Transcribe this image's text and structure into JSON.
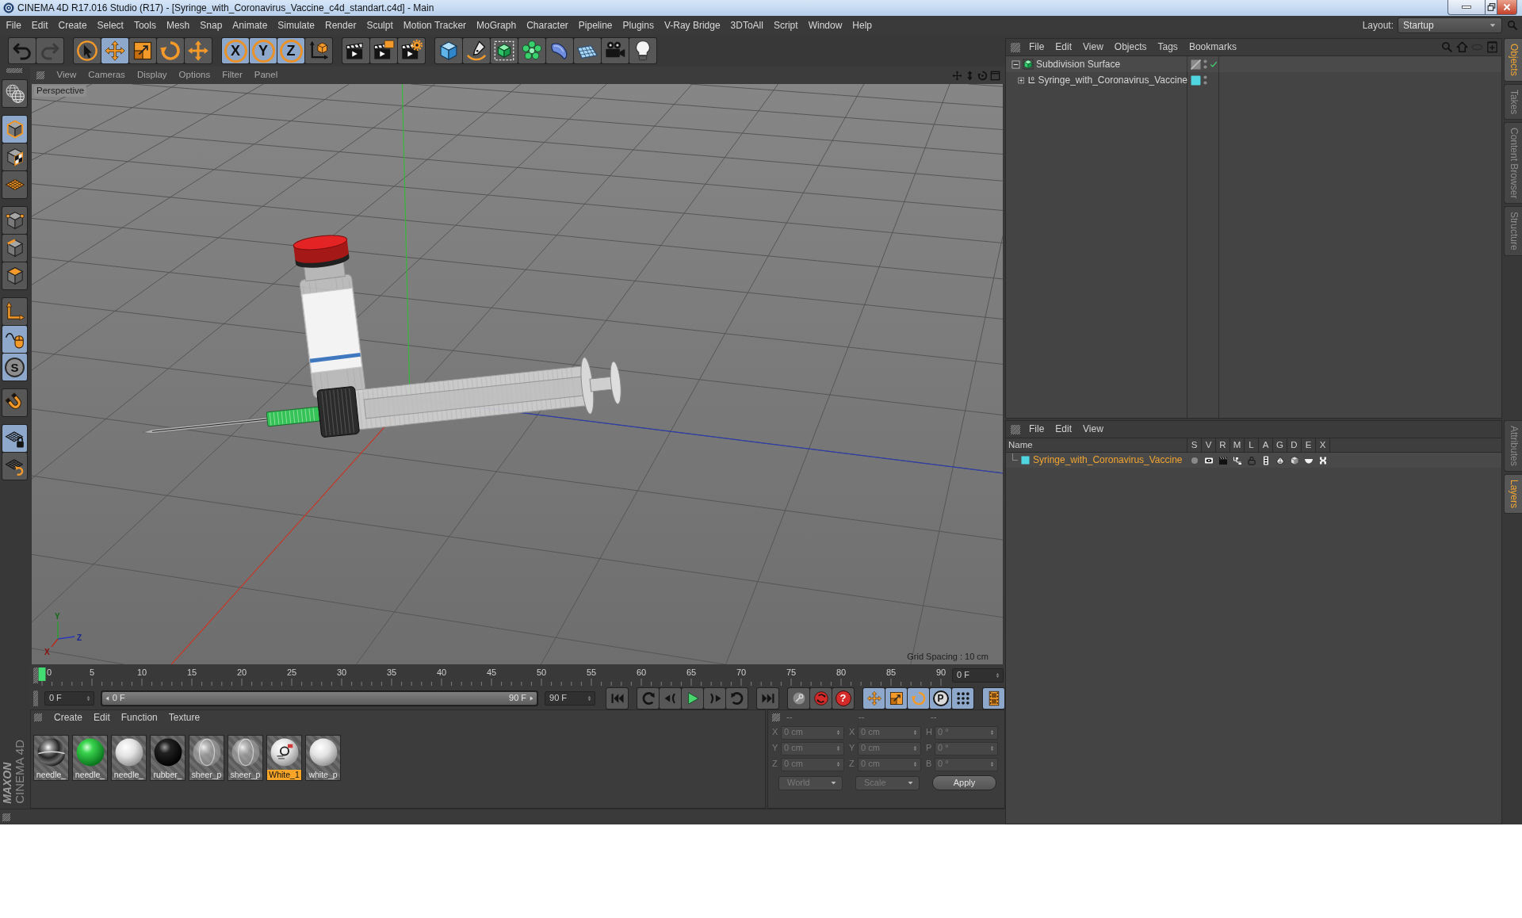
{
  "window": {
    "title": "CINEMA 4D R17.016 Studio (R17) - [Syringe_with_Coronavirus_Vaccine_c4d_standart.c4d] - Main"
  },
  "menu_bar": {
    "items": [
      "File",
      "Edit",
      "Create",
      "Select",
      "Tools",
      "Mesh",
      "Snap",
      "Animate",
      "Simulate",
      "Render",
      "Sculpt",
      "Motion Tracker",
      "MoGraph",
      "Character",
      "Pipeline",
      "Plugins",
      "V-Ray Bridge",
      "3DToAll",
      "Script",
      "Window",
      "Help"
    ],
    "layout_label": "Layout:",
    "layout_value": "Startup"
  },
  "toolbar": {
    "groups": [
      {
        "buttons": [
          {
            "kind": "undo",
            "active": false,
            "disabled": false
          },
          {
            "kind": "redo",
            "active": false,
            "disabled": true
          }
        ]
      },
      {
        "buttons": [
          {
            "kind": "live_selection",
            "active": false
          },
          {
            "kind": "move",
            "active": true
          },
          {
            "kind": "scale",
            "active": false
          },
          {
            "kind": "rotate",
            "active": false
          },
          {
            "kind": "recent_tool",
            "active": false
          }
        ]
      },
      {
        "buttons": [
          {
            "kind": "axis_lock",
            "label": "X",
            "active": true
          },
          {
            "kind": "axis_lock",
            "label": "Y",
            "active": true
          },
          {
            "kind": "axis_lock",
            "label": "Z",
            "active": true
          },
          {
            "kind": "coordinate_system",
            "active": false
          }
        ]
      },
      {
        "buttons": [
          {
            "kind": "render_view",
            "active": false
          },
          {
            "kind": "render_picture",
            "active": false
          },
          {
            "kind": "render_settings",
            "active": false
          }
        ]
      },
      {
        "buttons": [
          {
            "kind": "cube",
            "active": false
          },
          {
            "kind": "pen",
            "active": false
          },
          {
            "kind": "subdivision",
            "active": false
          },
          {
            "kind": "cloner",
            "active": false
          },
          {
            "kind": "deformer",
            "active": false
          },
          {
            "kind": "floor",
            "active": false
          },
          {
            "kind": "camera",
            "active": false
          },
          {
            "kind": "light",
            "active": false
          }
        ]
      }
    ]
  },
  "tool_palette": {
    "groups": [
      {
        "buttons": [
          {
            "kind": "make_editable",
            "active": false
          }
        ]
      },
      {
        "buttons": [
          {
            "kind": "model_mode",
            "active": true
          },
          {
            "kind": "texture_mode",
            "active": false
          },
          {
            "kind": "workplane_mode",
            "active": false
          }
        ]
      },
      {
        "buttons": [
          {
            "kind": "points_mode",
            "active": false
          },
          {
            "kind": "edges_mode",
            "active": false
          },
          {
            "kind": "polygons_mode",
            "active": false
          }
        ]
      },
      {
        "buttons": [
          {
            "kind": "axis_mode",
            "active": false
          },
          {
            "kind": "tweak_mode",
            "active": true
          },
          {
            "kind": "solo",
            "label": "S",
            "active": true
          }
        ]
      },
      {
        "buttons": [
          {
            "kind": "snap",
            "active": false
          }
        ]
      },
      {
        "buttons": [
          {
            "kind": "lock_workplane",
            "active": true
          },
          {
            "kind": "align_workplane",
            "active": false
          }
        ]
      }
    ]
  },
  "viewport": {
    "menu": [
      "View",
      "Cameras",
      "Display",
      "Options",
      "Filter",
      "Panel"
    ],
    "camera": "Perspective",
    "gizmo_labels": [
      "Y",
      "Z",
      "X"
    ],
    "grid_spacing": "Grid Spacing : 10 cm"
  },
  "timeline": {
    "ticks": [
      {
        "label": "0",
        "current": true
      },
      {
        "label": "5",
        "current": false
      },
      {
        "label": "10",
        "current": false
      },
      {
        "label": "15",
        "current": false
      },
      {
        "label": "20",
        "current": false
      },
      {
        "label": "25",
        "current": false
      },
      {
        "label": "30",
        "current": false
      },
      {
        "label": "35",
        "current": false
      },
      {
        "label": "40",
        "current": false
      },
      {
        "label": "45",
        "current": false
      },
      {
        "label": "50",
        "current": false
      },
      {
        "label": "55",
        "current": false
      },
      {
        "label": "60",
        "current": false
      },
      {
        "label": "65",
        "current": false
      },
      {
        "label": "70",
        "current": false
      },
      {
        "label": "75",
        "current": false
      },
      {
        "label": "80",
        "current": false
      },
      {
        "label": "85",
        "current": false
      },
      {
        "label": "90",
        "current": false
      }
    ],
    "frame_field": "0 F"
  },
  "playback": {
    "start_field": "0 F",
    "range": {
      "start": "0 F",
      "end": "90 F",
      "level": 1
    },
    "end_field": "90 F",
    "groups": [
      {
        "buttons": [
          {
            "kind": "go_start",
            "active": false
          }
        ]
      },
      {
        "buttons": [
          {
            "kind": "prev_key",
            "active": false
          },
          {
            "kind": "prev_frame",
            "active": false
          },
          {
            "kind": "play",
            "active": false
          },
          {
            "kind": "next_frame",
            "active": false
          },
          {
            "kind": "next_key",
            "active": false
          }
        ]
      },
      {
        "buttons": [
          {
            "kind": "go_end",
            "active": false
          }
        ]
      },
      {
        "buttons": [
          {
            "kind": "autokey",
            "active": false
          },
          {
            "kind": "record",
            "active": false
          },
          {
            "kind": "key_help",
            "label": "?",
            "active": false
          }
        ]
      },
      {
        "buttons": [
          {
            "kind": "key_move",
            "active": true
          },
          {
            "kind": "key_scale",
            "active": true
          },
          {
            "kind": "key_rotate",
            "active": true
          },
          {
            "kind": "key_param",
            "label": "P",
            "active": true
          },
          {
            "kind": "key_pla",
            "active": true
          }
        ]
      },
      {
        "buttons": [
          {
            "kind": "timeline",
            "active": true
          }
        ]
      }
    ]
  },
  "materials": {
    "menu": [
      "Create",
      "Edit",
      "Function",
      "Texture"
    ],
    "items": [
      {
        "label": "needle_",
        "kind": "chrome",
        "selected": false
      },
      {
        "label": "needle_",
        "kind": "green",
        "selected": false
      },
      {
        "label": "needle_",
        "kind": "white",
        "selected": false
      },
      {
        "label": "rubber_",
        "kind": "black",
        "selected": false
      },
      {
        "label": "sheer_p",
        "kind": "glass",
        "selected": false
      },
      {
        "label": "sheer_p",
        "kind": "glass",
        "selected": false
      },
      {
        "label": "White_1",
        "kind": "decal",
        "selected": true
      },
      {
        "label": "white_p",
        "kind": "white",
        "selected": false
      }
    ]
  },
  "coordinates": {
    "disabled": true,
    "headers": [
      "--",
      "--",
      "--"
    ],
    "rows": [
      [
        {
          "axis": "X",
          "value": "0 cm"
        },
        {
          "axis": "X",
          "value": "0 cm"
        },
        {
          "axis": "H",
          "value": "0 °"
        }
      ],
      [
        {
          "axis": "Y",
          "value": "0 cm"
        },
        {
          "axis": "Y",
          "value": "0 cm"
        },
        {
          "axis": "P",
          "value": "0 °"
        }
      ],
      [
        {
          "axis": "Z",
          "value": "0 cm"
        },
        {
          "axis": "Z",
          "value": "0 cm"
        },
        {
          "axis": "B",
          "value": "0 °"
        }
      ]
    ],
    "dropdowns": [
      "World",
      "Scale"
    ],
    "apply": "Apply"
  },
  "logo": {
    "brand": "MAXON",
    "product": "CINEMA 4D"
  },
  "objects_panel": {
    "menu": [
      "File",
      "Edit",
      "View",
      "Objects",
      "Tags",
      "Bookmarks"
    ],
    "tree": [
      {
        "name": "Subdivision Surface",
        "kind": "subdivision",
        "expanded": true,
        "generator_check": true,
        "children": [
          {
            "name": "Syringe_with_Coronavirus_Vaccine",
            "kind": "null",
            "expanded": false,
            "generator_check": false,
            "color": "#4fd6e0"
          }
        ]
      }
    ]
  },
  "layers_panel": {
    "menu": [
      "File",
      "Edit",
      "View"
    ],
    "columns": [
      "Name",
      "S",
      "V",
      "R",
      "M",
      "L",
      "A",
      "G",
      "D",
      "E",
      "X"
    ],
    "layers": [
      {
        "name": "Syringe_with_Coronavirus_Vaccine",
        "color": "#4fd6e0",
        "selected": true
      }
    ]
  },
  "side_tabs": {
    "top": [
      {
        "label": "Objects",
        "selected": true
      },
      {
        "label": "Takes",
        "selected": false
      },
      {
        "label": "Content Browser",
        "selected": false
      },
      {
        "label": "Structure",
        "selected": false
      }
    ],
    "bottom": [
      {
        "label": "Attributes",
        "selected": false
      },
      {
        "label": "Layers",
        "selected": true
      }
    ]
  }
}
